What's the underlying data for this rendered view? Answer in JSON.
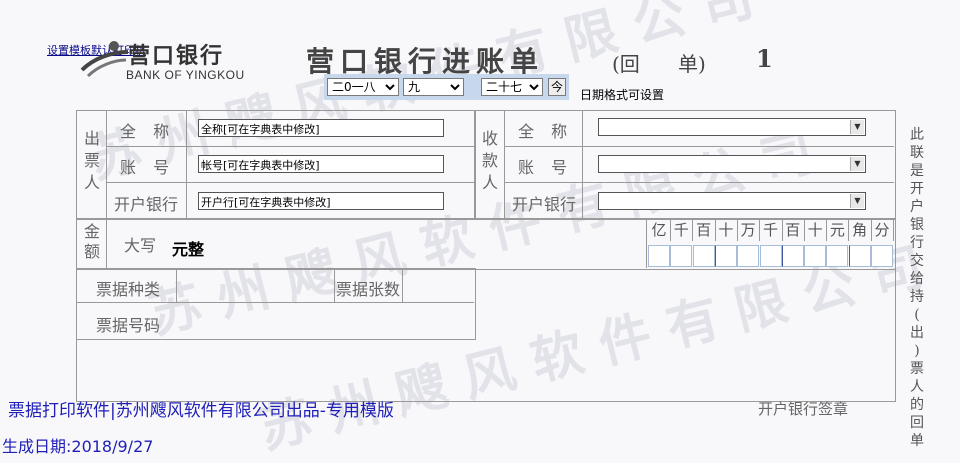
{
  "template_link": "设置模板默认打印机",
  "bank": {
    "name_cn": "营口银行",
    "name_en": "BANK OF YINGKOU"
  },
  "title": "营口银行进账单",
  "subtitle_open": "(回",
  "subtitle_close": "单)",
  "copy_number": "1",
  "date": {
    "year": "二0一八",
    "month": "九",
    "day": "二十七",
    "today_label": "今",
    "hint": "日期格式可设置"
  },
  "payer": {
    "side_label": [
      "出",
      "票",
      "人"
    ],
    "name_label": "全 称",
    "name_value": "全称[可在字典表中修改]",
    "account_label": "账 号",
    "account_value": "帐号[可在字典表中修改]",
    "bank_label": "开户银行",
    "bank_value": "开户行[可在字典表中修改]"
  },
  "payee": {
    "side_label": [
      "收",
      "款",
      "人"
    ],
    "name_label": "全 称",
    "account_label": "账 号",
    "bank_label": "开户银行"
  },
  "amount": {
    "side_label": [
      "金",
      "额"
    ],
    "words_label": "大写",
    "words_value": "元整",
    "digit_headers": [
      "亿",
      "千",
      "百",
      "十",
      "万",
      "千",
      "百",
      "十",
      "元",
      "角",
      "分"
    ]
  },
  "bill_type_label": "票据种类",
  "bill_count_label": "票据张数",
  "bill_number_label": "票据号码",
  "seal_label": "开户银行签章",
  "vertical_note": "此联是开户银行交给持(出)票人的回单",
  "watermark": [
    "苏州飕风软件有限公司",
    "苏州飕风软件有限公司",
    "苏州飕风软件有限公司"
  ],
  "footer_line1": "票据打印软件|苏州飕风软件有限公司出品-专用模版",
  "footer_line2": "生成日期:2018/9/27"
}
